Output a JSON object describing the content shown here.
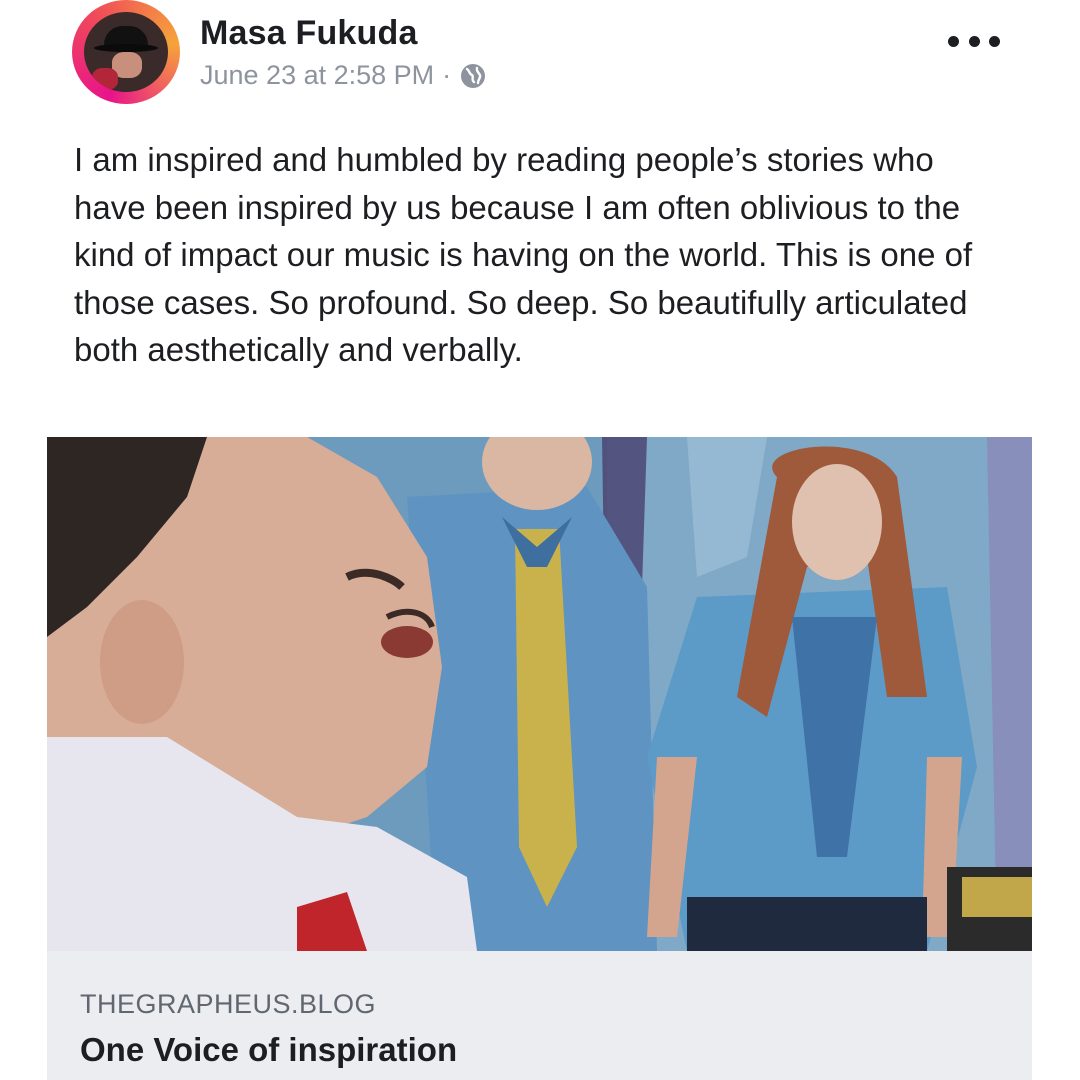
{
  "post": {
    "author": {
      "name": "Masa Fukuda"
    },
    "timestamp": "June 23 at 2:58 PM",
    "separator": "·",
    "privacy_icon": "globe-icon",
    "more_icon": "more-options-icon",
    "text": "I am inspired and humbled by reading people’s stories who have been inspired by us because I am often oblivious to the kind of impact our music is having on the world. This is one of those cases. So profound. So deep. So beautifully articulated both aesthetically and verbally.",
    "link": {
      "domain": "THEGRAPHEUS.BLOG",
      "title": "One Voice of inspiration"
    }
  },
  "colors": {
    "text_primary": "#1c1e21",
    "text_secondary": "#8d949e",
    "link_card_bg": "#ebedf0",
    "avatar_ring": "#e8138a"
  }
}
